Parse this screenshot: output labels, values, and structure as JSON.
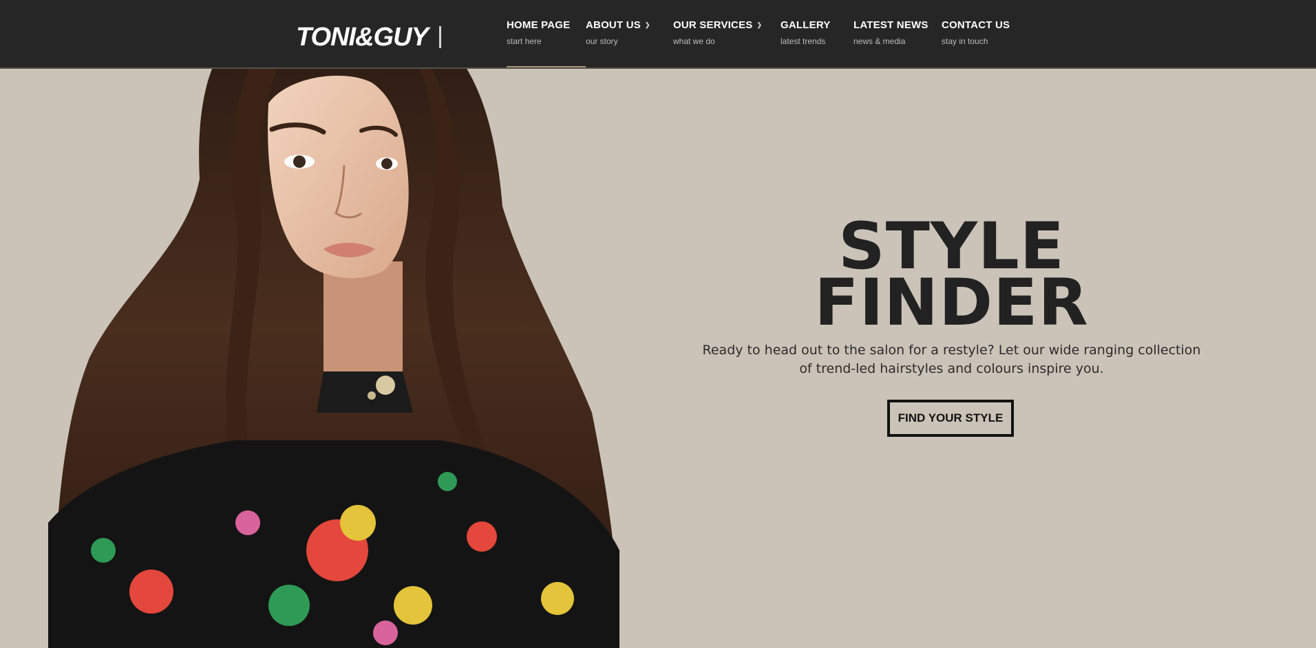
{
  "header": {
    "logo_text": "TONI&GUY",
    "nav": [
      {
        "label": "HOME PAGE",
        "sub": "start here",
        "has_dropdown": false,
        "active": true
      },
      {
        "label": "ABOUT US",
        "sub": "our story",
        "has_dropdown": true,
        "active": false
      },
      {
        "label": "OUR SERVICES",
        "sub": "what we do",
        "has_dropdown": true,
        "active": false
      },
      {
        "label": "GALLERY",
        "sub": "latest trends",
        "has_dropdown": false,
        "active": false
      },
      {
        "label": "LATEST NEWS",
        "sub": "news & media",
        "has_dropdown": false,
        "active": false
      },
      {
        "label": "CONTACT US",
        "sub": "stay in touch",
        "has_dropdown": false,
        "active": false
      }
    ],
    "dropdown_icon": "chevron-down-icon"
  },
  "hero": {
    "title_line1": "STYLE",
    "title_line2": "FINDER",
    "description": "Ready to head out to the salon for a restyle? Let our wide ranging collection of trend-led hairstyles and colours inspire you.",
    "button_label": "FIND YOUR STYLE",
    "image": "model-portrait"
  },
  "colors": {
    "topbar": "#262626",
    "background": "#cbc3b8",
    "active_underline": "#a89478",
    "heading": "#222222"
  }
}
